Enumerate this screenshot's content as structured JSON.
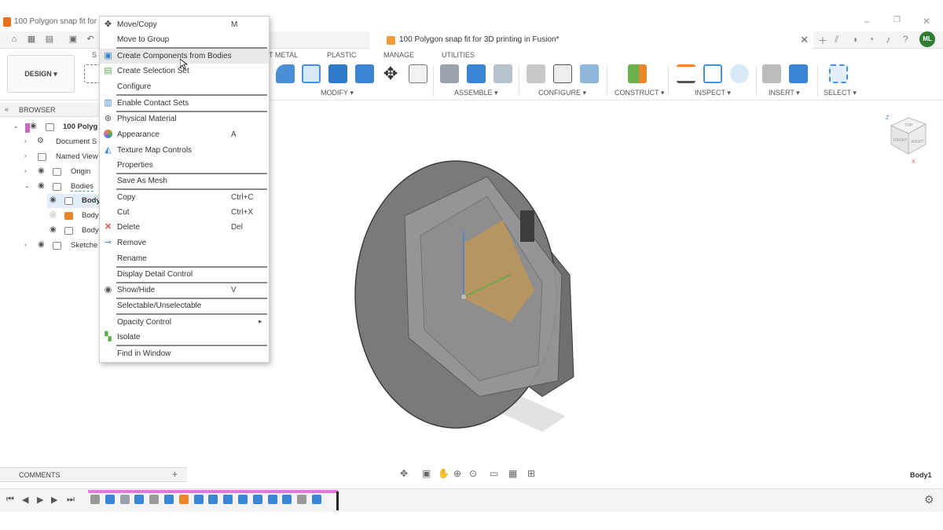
{
  "window": {
    "title": "100 Polygon snap fit for 3D printing in Fusion*",
    "title_truncated": "100 Polygon snap fit for 3D",
    "min_btn": "–",
    "max_btn": "❐",
    "close_btn": "✕"
  },
  "document_tab": {
    "title": "100 Polygon snap fit for 3D printing in Fusion*",
    "close": "✕"
  },
  "account": {
    "initials": "ML"
  },
  "workspace": {
    "label": "DESIGN ▾"
  },
  "ribbon": {
    "tabs": [
      "S",
      "T METAL",
      "PLASTIC",
      "MANAGE",
      "UTILITIES"
    ],
    "groups": [
      "MODIFY ▾",
      "ASSEMBLE ▾",
      "CONFIGURE ▾",
      "CONSTRUCT ▾",
      "INSPECT ▾",
      "INSERT ▾",
      "SELECT ▾"
    ]
  },
  "browser": {
    "title": "BROWSER",
    "collapse": "«",
    "items": [
      {
        "label": "100 Polyg"
      },
      {
        "label": "Document S"
      },
      {
        "label": "Named View"
      },
      {
        "label": "Origin"
      },
      {
        "label": "Bodies"
      },
      {
        "label": "Body"
      },
      {
        "label": "Body"
      },
      {
        "label": "Body"
      },
      {
        "label": "Sketche"
      }
    ]
  },
  "context_menu": {
    "items": [
      {
        "label": "Move/Copy",
        "shortcut": "M",
        "icon": "move-icon"
      },
      {
        "label": "Move to Group",
        "shortcut": "",
        "icon": ""
      },
      {
        "label": "Create Components from Bodies",
        "shortcut": "",
        "icon": "component-icon"
      },
      {
        "label": "Create Selection Set",
        "shortcut": "",
        "icon": "selection-set-icon"
      },
      {
        "label": "Configure",
        "shortcut": "",
        "icon": ""
      },
      {
        "label": "Enable Contact Sets",
        "shortcut": "",
        "icon": "contact-sets-icon"
      },
      {
        "label": "Physical Material",
        "shortcut": "",
        "icon": "material-icon"
      },
      {
        "label": "Appearance",
        "shortcut": "A",
        "icon": "appearance-icon"
      },
      {
        "label": "Texture Map Controls",
        "shortcut": "",
        "icon": "texture-icon"
      },
      {
        "label": "Properties",
        "shortcut": "",
        "icon": ""
      },
      {
        "label": "Save As Mesh",
        "shortcut": "",
        "icon": ""
      },
      {
        "label": "Copy",
        "shortcut": "Ctrl+C",
        "icon": ""
      },
      {
        "label": "Cut",
        "shortcut": "Ctrl+X",
        "icon": ""
      },
      {
        "label": "Delete",
        "shortcut": "Del",
        "icon": "delete-icon"
      },
      {
        "label": "Remove",
        "shortcut": "",
        "icon": "remove-icon"
      },
      {
        "label": "Rename",
        "shortcut": "",
        "icon": ""
      },
      {
        "label": "Display Detail Control",
        "shortcut": "",
        "icon": ""
      },
      {
        "label": "Show/Hide",
        "shortcut": "V",
        "icon": "eye-icon"
      },
      {
        "label": "Selectable/Unselectable",
        "shortcut": "",
        "icon": ""
      },
      {
        "label": "Opacity Control",
        "shortcut": "",
        "icon": ""
      },
      {
        "label": "Isolate",
        "shortcut": "",
        "icon": "isolate-icon"
      },
      {
        "label": "Find in Window",
        "shortcut": "",
        "icon": ""
      }
    ]
  },
  "comments": {
    "title": "COMMENTS",
    "add": "+"
  },
  "status": {
    "selected_body": "Body1"
  },
  "viewcube": {
    "top": "TOP",
    "front": "FRONT",
    "right": "RIGHT",
    "z": "Z",
    "x": "X"
  },
  "colors": {
    "accent": "#0696d7",
    "timeline": "#e27ad9",
    "avatar": "#2e7d32"
  }
}
